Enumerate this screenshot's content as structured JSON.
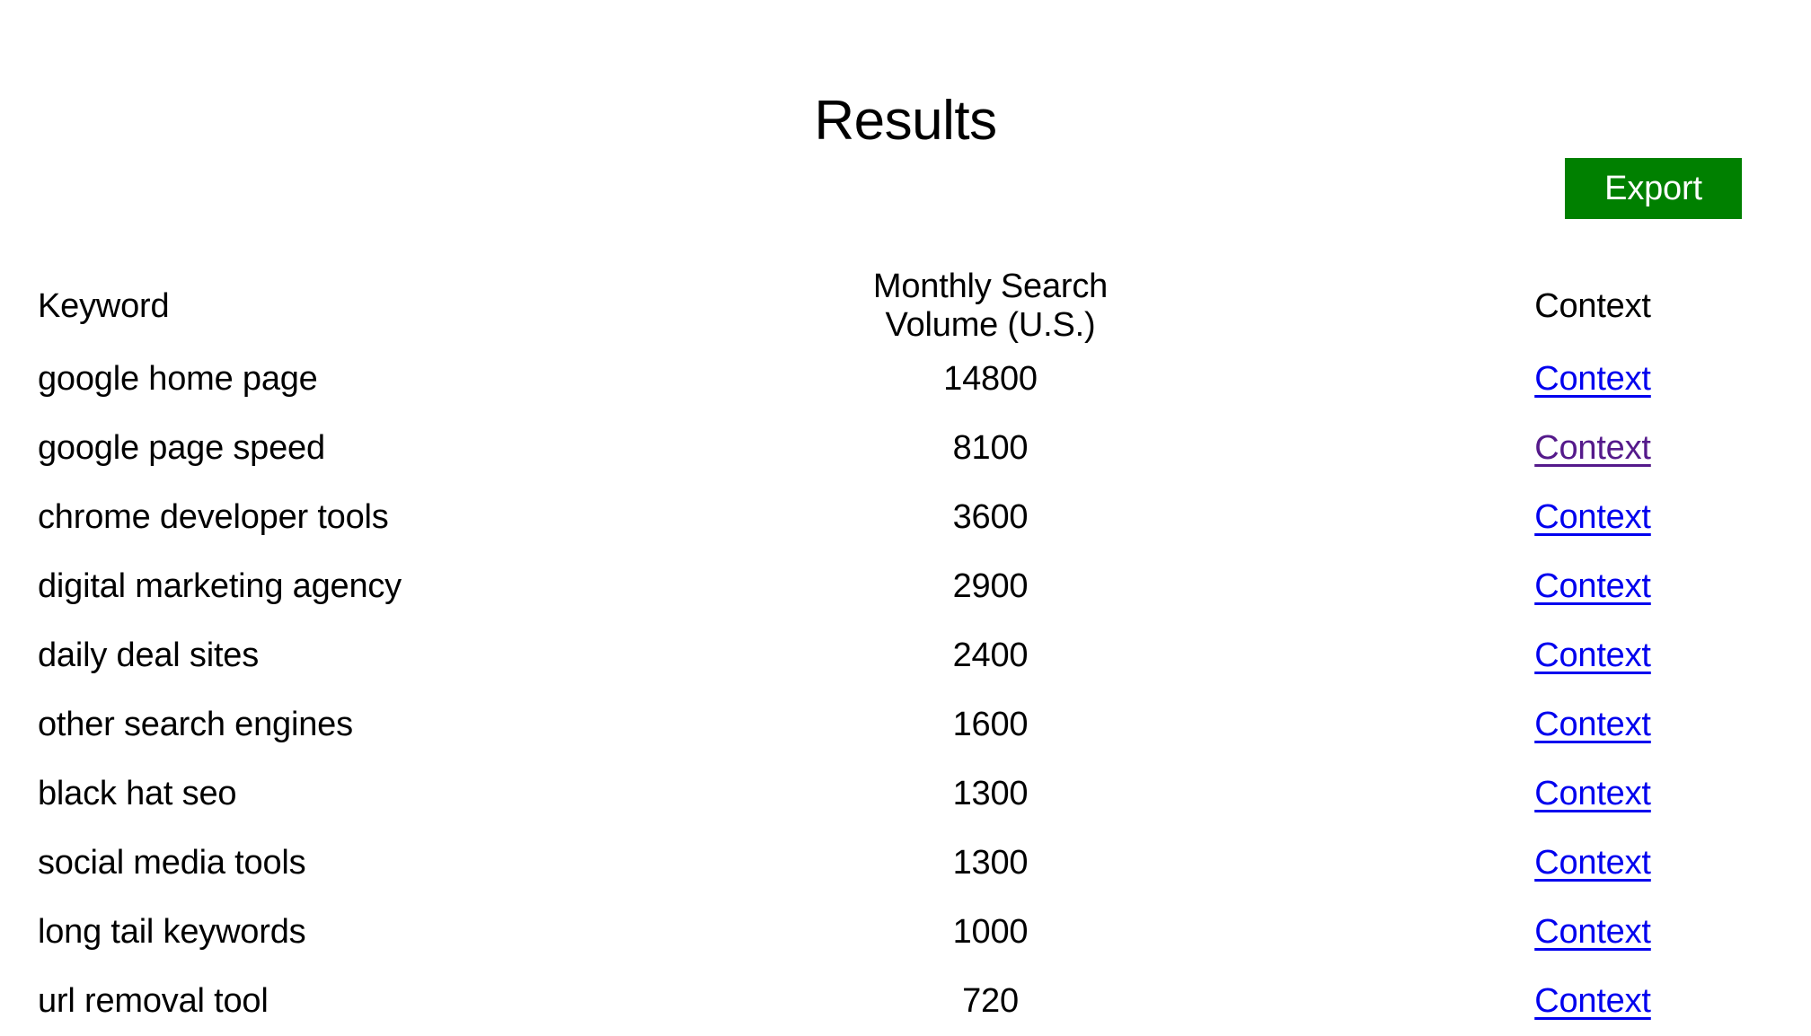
{
  "page": {
    "title": "Results",
    "background_color": "#ffffff",
    "text_color": "#000000"
  },
  "toolbar": {
    "export_label": "Export",
    "export_bg_color": "#008000",
    "export_text_color": "#ffffff"
  },
  "table": {
    "columns": [
      {
        "key": "keyword",
        "label": "Keyword",
        "align": "left"
      },
      {
        "key": "volume",
        "label": "Monthly Search Volume (U.S.)",
        "align": "center"
      },
      {
        "key": "context",
        "label": "Context",
        "align": "center"
      }
    ],
    "link_colors": {
      "unvisited": "#0000ee",
      "visited": "#551a8b"
    },
    "rows": [
      {
        "keyword": "google home page",
        "volume": "14800",
        "context_label": "Context",
        "visited": false
      },
      {
        "keyword": "google page speed",
        "volume": "8100",
        "context_label": "Context",
        "visited": true
      },
      {
        "keyword": "chrome developer tools",
        "volume": "3600",
        "context_label": "Context",
        "visited": false
      },
      {
        "keyword": "digital marketing agency",
        "volume": "2900",
        "context_label": "Context",
        "visited": false
      },
      {
        "keyword": "daily deal sites",
        "volume": "2400",
        "context_label": "Context",
        "visited": false
      },
      {
        "keyword": "other search engines",
        "volume": "1600",
        "context_label": "Context",
        "visited": false
      },
      {
        "keyword": "black hat seo",
        "volume": "1300",
        "context_label": "Context",
        "visited": false
      },
      {
        "keyword": "social media tools",
        "volume": "1300",
        "context_label": "Context",
        "visited": false
      },
      {
        "keyword": "long tail keywords",
        "volume": "1000",
        "context_label": "Context",
        "visited": false
      },
      {
        "keyword": "url removal tool",
        "volume": "720",
        "context_label": "Context",
        "visited": false
      }
    ]
  }
}
